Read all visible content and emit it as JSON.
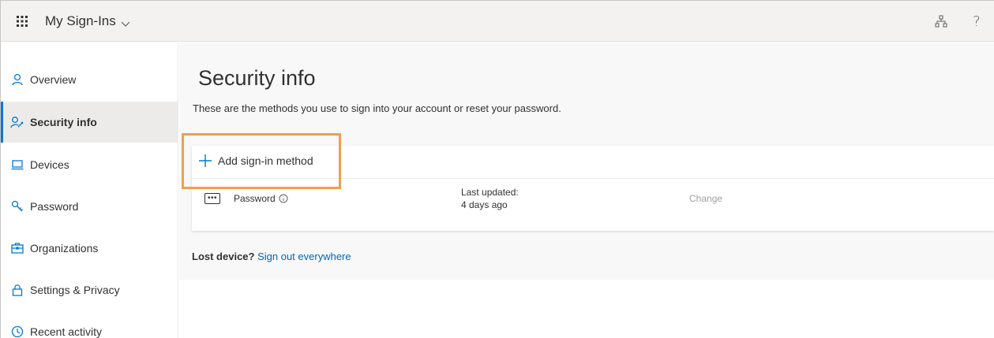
{
  "header": {
    "app_title": "My Sign-Ins",
    "help_label": "?"
  },
  "sidebar": {
    "items": [
      {
        "label": "Overview",
        "icon": "person-icon"
      },
      {
        "label": "Security info",
        "icon": "person-key-icon"
      },
      {
        "label": "Devices",
        "icon": "laptop-icon"
      },
      {
        "label": "Password",
        "icon": "key-icon"
      },
      {
        "label": "Organizations",
        "icon": "briefcase-icon"
      },
      {
        "label": "Settings & Privacy",
        "icon": "lock-icon"
      },
      {
        "label": "Recent activity",
        "icon": "history-icon"
      }
    ],
    "active": "Security info"
  },
  "main": {
    "title": "Security info",
    "description": "These are the methods you use to sign into your account or reset your password.",
    "add_method_label": "Add sign-in method",
    "methods": [
      {
        "name": "Password",
        "updated_label": "Last updated:",
        "updated_value": "4 days ago",
        "action": "Change"
      }
    ],
    "lost_device_label": "Lost device?",
    "signout_link": "Sign out everywhere"
  },
  "colors": {
    "accent": "#0078d4",
    "link": "#0067b8",
    "highlight": "#f0a04b"
  }
}
